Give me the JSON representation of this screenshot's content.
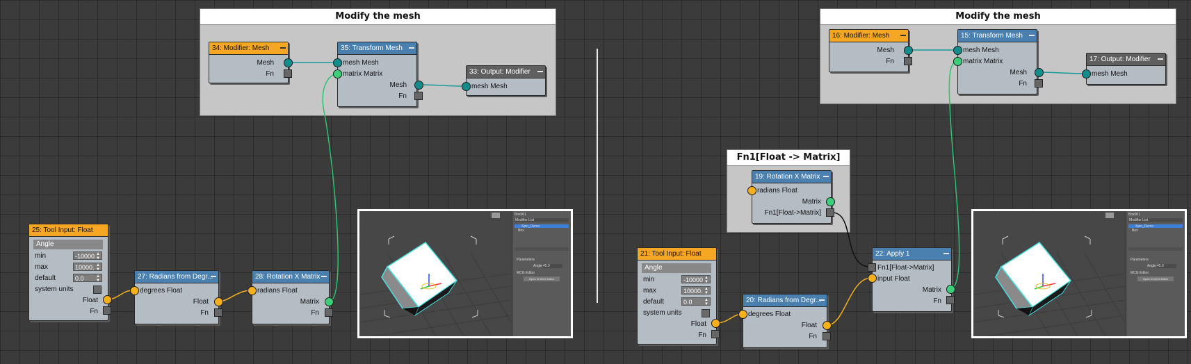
{
  "left": {
    "group": {
      "title": "Modify the mesh"
    },
    "n34": {
      "title": "34: Modifier: Mesh",
      "out_mesh": "Mesh",
      "fn": "Fn"
    },
    "n35": {
      "title": "35: Transform Mesh",
      "in_mesh": "mesh Mesh",
      "in_matrix": "matrix Matrix",
      "out_mesh": "Mesh",
      "fn": "Fn"
    },
    "n33": {
      "title": "33: Output: Modifier",
      "in_mesh": "mesh Mesh"
    },
    "n25": {
      "title": "25: Tool Input: Float",
      "param_header": "Angle",
      "min_label": "min",
      "min_value": "-10000",
      "max_label": "max",
      "max_value": "10000.",
      "default_label": "default",
      "default_value": "0.0",
      "units_label": "system units",
      "out_float": "Float",
      "fn": "Fn"
    },
    "n27": {
      "title": "27: Radians from Degr...",
      "in_degrees": "degrees Float",
      "out_float": "Float",
      "fn": "Fn"
    },
    "n28": {
      "title": "28: Rotation X Matrix",
      "in_radians": "radians Float",
      "out_matrix": "Matrix",
      "fn": "Fn"
    }
  },
  "right": {
    "group": {
      "title": "Modify the mesh"
    },
    "fn_group": {
      "title": "Fn1[Float -> Matrix]"
    },
    "n16": {
      "title": "16: Modifier: Mesh",
      "out_mesh": "Mesh",
      "fn": "Fn"
    },
    "n15": {
      "title": "15: Transform Mesh",
      "in_mesh": "mesh Mesh",
      "in_matrix": "matrix Matrix",
      "out_mesh": "Mesh",
      "fn": "Fn"
    },
    "n17": {
      "title": "17: Output: Modifier",
      "in_mesh": "mesh Mesh"
    },
    "n19": {
      "title": "19: Rotation X Matrix",
      "in_radians": "radians Float",
      "out_matrix": "Matrix",
      "out_fn": "Fn1[Float->Matrix]"
    },
    "n21": {
      "title": "21: Tool Input: Float",
      "param_header": "Angle",
      "min_label": "min",
      "min_value": "-10000",
      "max_label": "max",
      "max_value": "10000.",
      "default_label": "default",
      "default_value": "0.0",
      "units_label": "system units",
      "out_float": "Float",
      "fn": "Fn"
    },
    "n20": {
      "title": "20: Radians from Degr...",
      "in_degrees": "degrees Float",
      "out_float": "Float",
      "fn": "Fn"
    },
    "n22": {
      "title": "22: Apply 1",
      "in_fn": "Fn1[Float->Matrix]",
      "in_float": "input Float",
      "out_matrix": "Matrix",
      "fn": "Fn"
    }
  },
  "viewport_panel": {
    "header": "Box001",
    "modifier_list": "Modifier List",
    "stack_item_1": "Spin_Demo",
    "stack_item_2": "Box",
    "rollout_params": "Parameters",
    "angle_label": "Angle",
    "angle_value": "45.0",
    "rollout_mcg": "MCG Editor",
    "open_button": "Open in MCG Editor"
  },
  "colors": {
    "wire_mesh": "#179a9a",
    "wire_matrix": "#2bc470",
    "wire_float": "#f5b01b",
    "wire_fn": "#111111",
    "node_blue": "#4a80b0",
    "node_orange": "#f5a623",
    "node_gray": "#5f5f5f"
  }
}
